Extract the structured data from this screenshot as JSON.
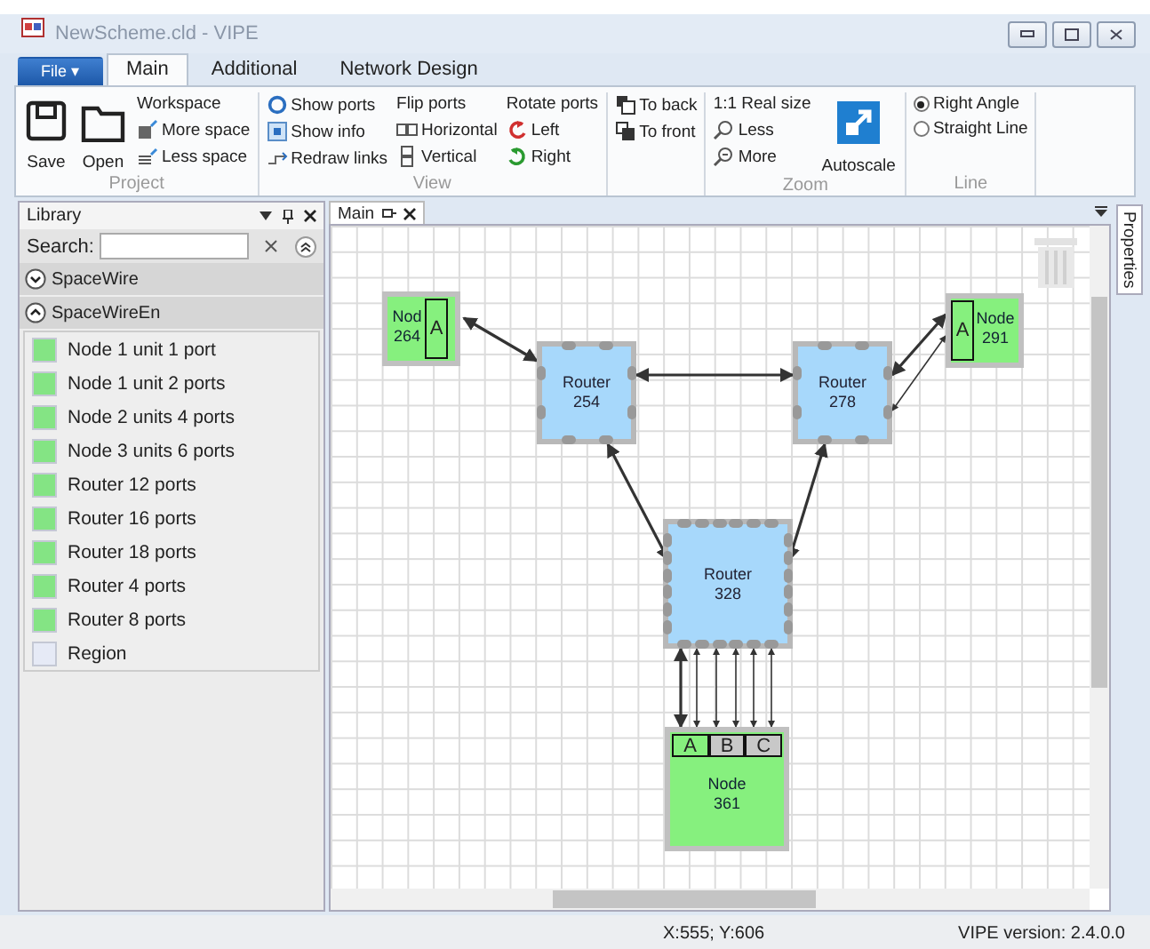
{
  "window": {
    "title": "NewScheme.cld - VIPE"
  },
  "ribbon_tabs": [
    {
      "label": "File ▾",
      "kind": "file",
      "selected": false
    },
    {
      "label": "Main",
      "kind": "tab",
      "selected": true
    },
    {
      "label": "Additional",
      "kind": "tab",
      "selected": false
    },
    {
      "label": "Network Design",
      "kind": "tab",
      "selected": false
    }
  ],
  "ribbon_groups": [
    {
      "label": "Project",
      "columns": [
        [
          {
            "kind": "large",
            "label": "Save"
          }
        ],
        [
          {
            "kind": "large",
            "label": "Open"
          }
        ],
        [
          {
            "kind": "heading",
            "label": "Workspace"
          },
          {
            "kind": "small",
            "label": "More space"
          },
          {
            "kind": "small",
            "label": "Less space"
          }
        ]
      ]
    },
    {
      "label": "View",
      "columns": [
        [
          {
            "kind": "small",
            "label": "Show ports"
          },
          {
            "kind": "small",
            "label": "Show info"
          },
          {
            "kind": "small",
            "label": "Redraw links"
          }
        ],
        [
          {
            "kind": "heading",
            "label": "Flip ports"
          },
          {
            "kind": "small",
            "label": "Horizontal"
          },
          {
            "kind": "small",
            "label": "Vertical"
          }
        ],
        [
          {
            "kind": "heading",
            "label": "Rotate ports"
          },
          {
            "kind": "small",
            "label": "Left"
          },
          {
            "kind": "small",
            "label": "Right"
          }
        ]
      ]
    },
    {
      "columns": [
        [
          {
            "kind": "small",
            "label": "To back"
          },
          {
            "kind": "small",
            "label": "To front"
          }
        ]
      ]
    },
    {
      "label": "Zoom",
      "columns": [
        [
          {
            "kind": "small",
            "label": "1:1 Real size"
          },
          {
            "kind": "small",
            "label": "Less"
          },
          {
            "kind": "small",
            "label": "More"
          }
        ],
        [
          {
            "kind": "large",
            "label": "Autoscale"
          }
        ]
      ]
    },
    {
      "label": "Line",
      "columns": [
        [
          {
            "kind": "radio",
            "label": "Right Angle",
            "selected": true
          },
          {
            "kind": "radio",
            "label": "Straight Line",
            "selected": false
          }
        ]
      ]
    }
  ],
  "library": {
    "title": "Library",
    "search_label": "Search:",
    "groups": [
      {
        "name": "SpaceWire",
        "expanded": false
      },
      {
        "name": "SpaceWireEn",
        "expanded": true,
        "items": [
          {
            "label": "Node 1 unit 1 port",
            "color": "#84e484"
          },
          {
            "label": "Node 1 unit 2 ports",
            "color": "#84e484"
          },
          {
            "label": "Node 2 units 4 ports",
            "color": "#84e484"
          },
          {
            "label": "Node 3 units 6 ports",
            "color": "#84e484"
          },
          {
            "label": "Router 12 ports",
            "color": "#84e484"
          },
          {
            "label": "Router 16 ports",
            "color": "#84e484"
          },
          {
            "label": "Router 18 ports",
            "color": "#84e484"
          },
          {
            "label": "Router 4 ports",
            "color": "#84e484"
          },
          {
            "label": "Router 8 ports",
            "color": "#84e484"
          },
          {
            "label": "Region",
            "color": "#e6eaf6"
          }
        ]
      }
    ]
  },
  "document_tab": {
    "label": "Main"
  },
  "side_tab": {
    "label": "Properties"
  },
  "diagram": {
    "nodes": [
      {
        "kind": "node",
        "name": "Nod",
        "number": "264",
        "ports": [
          {
            "label": "A",
            "connected": true
          }
        ]
      },
      {
        "kind": "router",
        "name": "Router",
        "number": "254"
      },
      {
        "kind": "router",
        "name": "Router",
        "number": "278"
      },
      {
        "kind": "node",
        "name": "Node",
        "number": "291",
        "ports": [
          {
            "label": "A",
            "connected": true
          }
        ]
      },
      {
        "kind": "router",
        "name": "Router",
        "number": "328"
      },
      {
        "kind": "node",
        "name": "Node",
        "number": "361",
        "ports": [
          {
            "label": "A",
            "connected": true
          },
          {
            "label": "B",
            "connected": false
          },
          {
            "label": "C",
            "connected": false
          }
        ]
      }
    ]
  },
  "status_bar": {
    "coordinates": "X:555; Y:606",
    "version": "VIPE version: 2.4.0.0"
  }
}
